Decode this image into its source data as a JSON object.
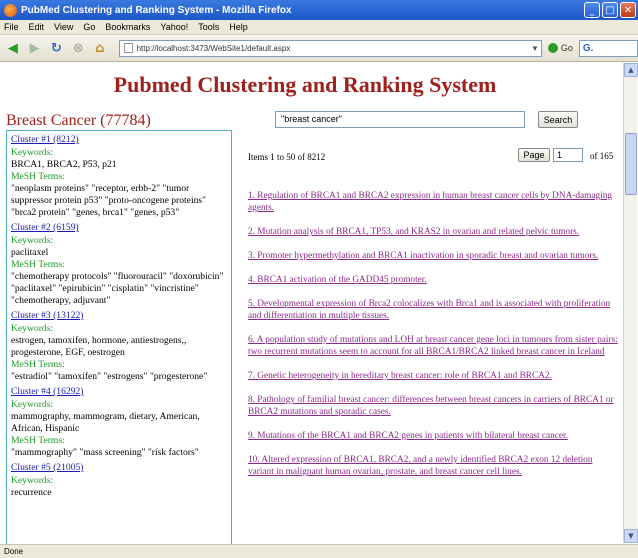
{
  "window": {
    "title": "PubMed Clustering and Ranking System - Mozilla Firefox"
  },
  "menu": [
    "File",
    "Edit",
    "View",
    "Go",
    "Bookmarks",
    "Yahoo!",
    "Tools",
    "Help"
  ],
  "nav": {
    "url": "http://localhost:3473/WebSite1/default.aspx",
    "go_label": "Go",
    "search_value": "G."
  },
  "page": {
    "title": "Pubmed Clustering and Ranking System",
    "topic": "Breast Cancer (77784)",
    "search_value": "\"breast cancer\"",
    "search_button": "Search",
    "items_label": "Items 1 to 50 of 8212",
    "page_button": "Page",
    "page_number": "1",
    "page_of": "of 165"
  },
  "clusters": [
    {
      "link": "Cluster #1 (8212)",
      "keywords_label": "Keywords:",
      "keywords": "BRCA1, BRCA2, P53, p21",
      "mesh_label": "MeSH Terms:",
      "mesh": "\"neoplasm proteins\" \"receptor, erbb-2\" \"tumor suppressor protein p53\" \"proto-oncogene proteins\" \"brca2 protein\" \"genes, brca1\" \"genes, p53\""
    },
    {
      "link": "Cluster #2 (6159)",
      "keywords_label": "Keywords:",
      "keywords": "paclitaxel",
      "mesh_label": "MeSH Terms:",
      "mesh": "\"chemotherapy protocols\" \"fluorouracil\" \"doxorubicin\" \"paclitaxel\" \"epirubicin\" \"cisplatin\" \"vincristine\" \"chemotherapy, adjuvant\""
    },
    {
      "link": "Cluster #3 (13122)",
      "keywords_label": "Keywords:",
      "keywords": "estrogen, tamoxifen, hormone, antiestrogens,, progesterone, EGF, oestrogen",
      "mesh_label": "MeSH Terms:",
      "mesh": "\"estradiol\" \"tamoxifen\" \"estrogens\" \"progesterone\""
    },
    {
      "link": "Cluster #4 (16292)",
      "keywords_label": "Keywords:",
      "keywords": "mammography, mammogram, dietary, American, African, Hispanic",
      "mesh_label": "MeSH Terms:",
      "mesh": "\"mammography\" \"mass screening\" \"risk factors\""
    },
    {
      "link": "Cluster #5 (21005)",
      "keywords_label": "Keywords:",
      "keywords": "recurrence",
      "mesh_label": "",
      "mesh": ""
    }
  ],
  "results": [
    "1. Regulation of BRCA1 and BRCA2 expression in human breast cancer cells by DNA-damaging agents.",
    "2. Mutation analysis of BRCA1, TP53, and KRAS2 in ovarian and related pelvic tumors.",
    "3. Promoter hypermethylation and BRCA1 inactivation in sporadic breast and ovarian tumors.",
    "4. BRCA1 activation of the GADD45 promoter.",
    "5. Developmental expression of Brca2 colocalizes with Brca1 and is associated with proliferation and differentiation in multiple tissues.",
    "6. A population study of mutations and LOH at breast cancer gene loci in tumours from sister pairs: two recurrent mutations seem to account for all BRCA1/BRCA2 linked breast cancer in Iceland",
    "7. Genetic heterogeneity in hereditary breast cancer: role of BRCA1 and BRCA2.",
    "8. Pathology of familial breast cancer: differences between breast cancers in carriers of BRCA1 or BRCA2 mutations and sporadic cases.",
    "9. Mutations of the BRCA1 and BRCA2 genes in patients with bilateral breast cancer.",
    "10. Altered expression of BRCA1, BRCA2, and a newly identified BRCA2 exon 12 deletion variant in malignant human ovarian, prostate, and breast cancer cell lines."
  ],
  "status": {
    "text": "Done"
  },
  "colors": {
    "title": "#a0201e",
    "link": "#1a1ab0",
    "visited": "#8a2a8a",
    "green_label": "#1f9a2a",
    "sidebar_border": "#4fb0c4"
  }
}
